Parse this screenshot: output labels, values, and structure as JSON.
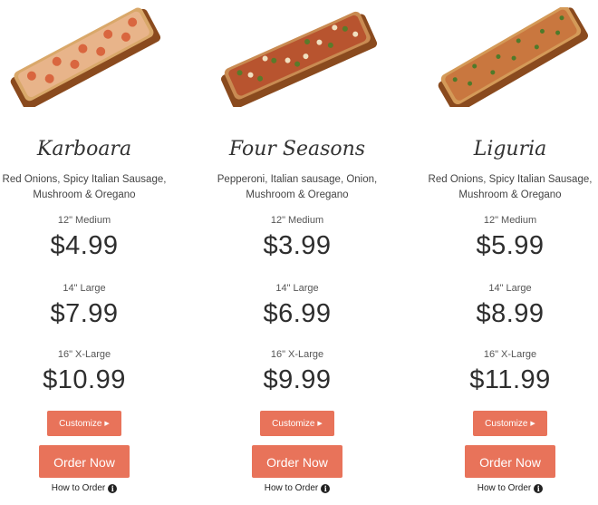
{
  "menu": {
    "pizzas": [
      {
        "name": "Karboara",
        "description": "Red Onions, Spicy Italian Sausage, Mushroom & Oregano",
        "sizes": [
          {
            "label": "12\" Medium",
            "price": "$4.99"
          },
          {
            "label": "14\" Large",
            "price": "$7.99"
          },
          {
            "label": "16\" X-Large",
            "price": "$10.99"
          }
        ],
        "customize_label": "Customize",
        "order_label": "Order Now",
        "how_to_label": "How to Order"
      },
      {
        "name": "Four Seasons",
        "description": "Pepperoni, Italian sausage, Onion, Mushroom & Oregano",
        "sizes": [
          {
            "label": "12\" Medium",
            "price": "$3.99"
          },
          {
            "label": "14\" Large",
            "price": "$6.99"
          },
          {
            "label": "16\" X-Large",
            "price": "$9.99"
          }
        ],
        "customize_label": "Customize",
        "order_label": "Order Now",
        "how_to_label": "How to Order"
      },
      {
        "name": "Liguria",
        "description": "Red Onions, Spicy Italian Sausage, Mushroom & Oregano",
        "sizes": [
          {
            "label": "12\" Medium",
            "price": "$5.99"
          },
          {
            "label": "14\" Large",
            "price": "$8.99"
          },
          {
            "label": "16\" X-Large",
            "price": "$11.99"
          }
        ],
        "customize_label": "Customize",
        "order_label": "Order Now",
        "how_to_label": "How to Order"
      }
    ]
  },
  "colors": {
    "accent": "#e8735a",
    "text": "#333333"
  },
  "icons": {
    "customize_arrow": "triangle-right-icon",
    "info": "info-circle-icon"
  }
}
